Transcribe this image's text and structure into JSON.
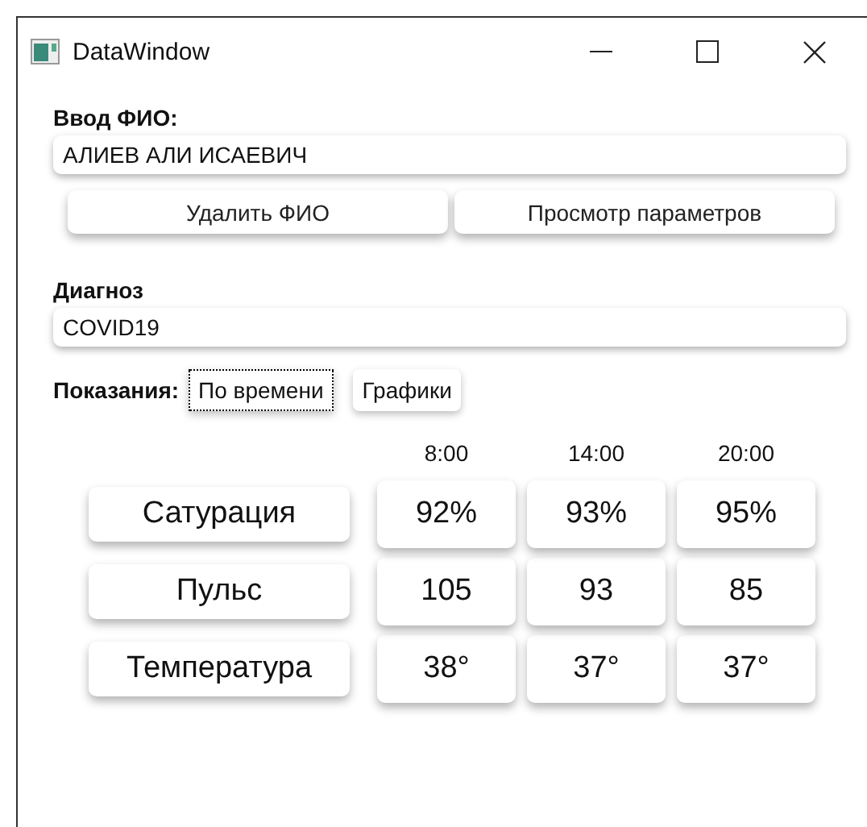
{
  "window": {
    "title": "DataWindow"
  },
  "name": {
    "label": "Ввод ФИО:",
    "value": "АЛИЕВ АЛИ ИСАЕВИЧ"
  },
  "actions": [
    "Удалить ФИО",
    "Просмотр параметров"
  ],
  "diagnosis": {
    "label": "Диагноз",
    "value": "COVID19"
  },
  "readings": {
    "label": "Показания:",
    "views": [
      {
        "label": "По времени",
        "focused": true
      },
      {
        "label": "Графики",
        "focused": false
      }
    ]
  },
  "table": {
    "columns": [
      "8:00",
      "14:00",
      "20:00"
    ],
    "rows": [
      {
        "name": "Сатурация",
        "values": [
          "92%",
          "93%",
          "95%"
        ]
      },
      {
        "name": "Пульс",
        "values": [
          "105",
          "93",
          "85"
        ]
      },
      {
        "name": "Температура",
        "values": [
          "38°",
          "37°",
          "37°"
        ]
      }
    ]
  }
}
